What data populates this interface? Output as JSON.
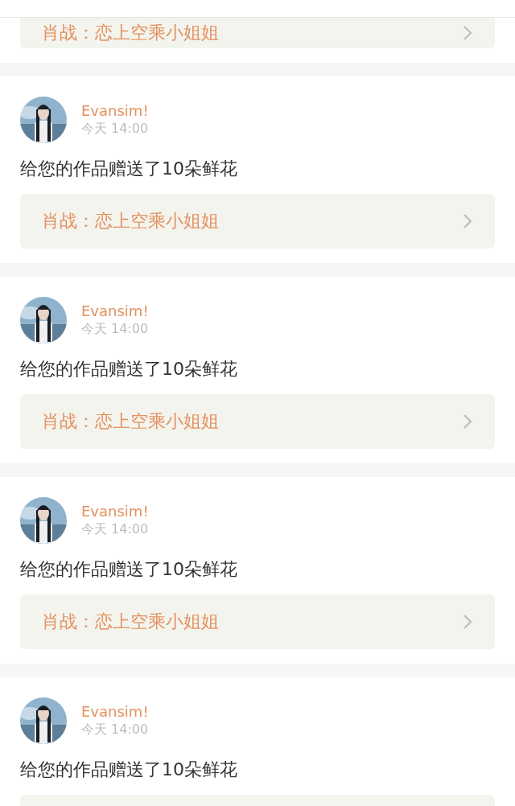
{
  "partial_item": {
    "link": "肖战：恋上空乘小姐姐"
  },
  "notifications": [
    {
      "user": "Evansim!",
      "time": "今天 14:00",
      "message": "给您的作品赠送了10朵鲜花",
      "link": "肖战：恋上空乘小姐姐"
    },
    {
      "user": "Evansim!",
      "time": "今天 14:00",
      "message": "给您的作品赠送了10朵鲜花",
      "link": "肖战：恋上空乘小姐姐"
    },
    {
      "user": "Evansim!",
      "time": "今天 14:00",
      "message": "给您的作品赠送了10朵鲜花",
      "link": "肖战：恋上空乘小姐姐"
    },
    {
      "user": "Evansim!",
      "time": "今天 14:00",
      "message": "给您的作品赠送了10朵鲜花"
    }
  ]
}
